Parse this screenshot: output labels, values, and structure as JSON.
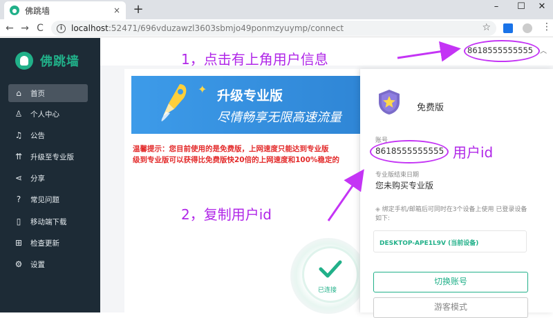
{
  "browser": {
    "tab_title": "佛跳墙",
    "tab_close": "×",
    "new_tab": "+",
    "win_min": "–",
    "win_max": "☐",
    "win_close": "✕",
    "nav_back": "←",
    "nav_forward": "→",
    "nav_reload": "C",
    "url_host": "localhost",
    "url_rest": ":52471/696vduzawzl3603sbmjo49ponmzyuymp/connect",
    "star": "☆",
    "menu": "⋮"
  },
  "app": {
    "brand": "佛跳墙",
    "nav": [
      {
        "label": "首页",
        "icon": "home-icon",
        "glyph": "⌂",
        "active": true
      },
      {
        "label": "个人中心",
        "icon": "user-icon",
        "glyph": "♙"
      },
      {
        "label": "公告",
        "icon": "bell-icon",
        "glyph": "♫"
      },
      {
        "label": "升级至专业版",
        "icon": "upgrade-icon",
        "glyph": "⇈"
      },
      {
        "label": "分享",
        "icon": "share-icon",
        "glyph": "⋖"
      },
      {
        "label": "常见问题",
        "icon": "help-icon",
        "glyph": "?"
      },
      {
        "label": "移动端下载",
        "icon": "phone-icon",
        "glyph": "▯"
      },
      {
        "label": "检查更新",
        "icon": "update-icon",
        "glyph": "⊞"
      },
      {
        "label": "设置",
        "icon": "settings-icon",
        "glyph": "⚙"
      }
    ],
    "user_account": "8618555555555",
    "banner_line1": "升级专业版",
    "banner_line2": "尽情畅享无限高速流量",
    "notice_line1": "温馨提示：您目前使用的是免费版，上网速度只能达到专业版",
    "notice_line2": "级到专业版可以获得比免费版快20倍的上网速度和100%稳定的",
    "connect_label": "已连接",
    "panel": {
      "plan": "免费版",
      "account_label": "账号",
      "account_value": "8618555555555",
      "expiry_label": "专业版结束日期",
      "expiry_value": "您未购买专业版",
      "bind_note": "绑定手机/邮箱后可同时在3个设备上使用 已登录设备如下:",
      "device": "DESKTOP-APE1L9V (当前设备)",
      "switch_button": "切换账号",
      "guest_button": "游客模式"
    }
  },
  "annotations": {
    "step1": "1，点击有上角用户信息",
    "step2": "2，复制用户id",
    "user_id": "用户id"
  },
  "colors": {
    "accent": "#21b089",
    "sidebar": "#1d2b36",
    "annotation": "#b026e8",
    "notice": "#e32b2b"
  }
}
